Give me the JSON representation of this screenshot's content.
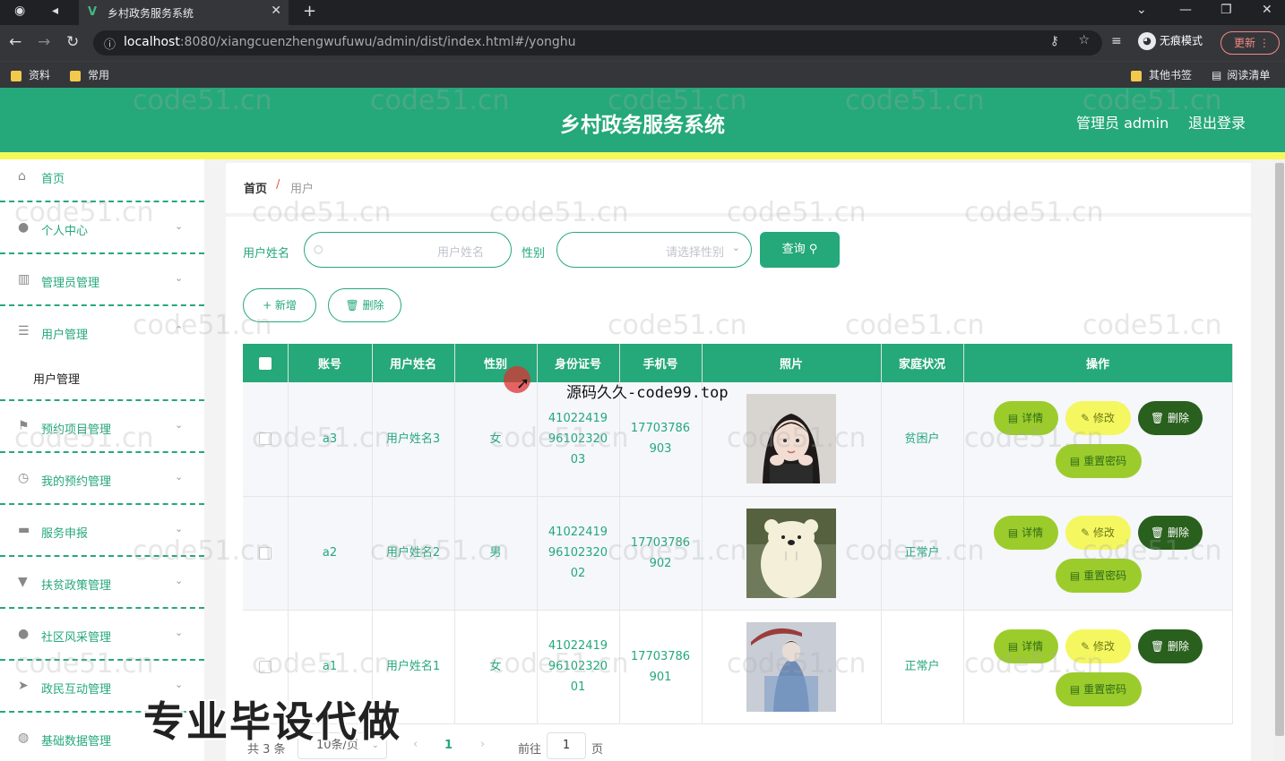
{
  "browser": {
    "tab_title": "乡村政务服务系统",
    "tab_logo": "V",
    "url_host": "localhost",
    "url_rest": ":8080/xiangcuenzhengwufuwu/admin/dist/index.html#/yonghu",
    "incognito_label": "无痕模式",
    "update_label": "更新",
    "bookmarks": [
      "资料",
      "常用"
    ],
    "bookmarks_right": [
      "其他书签",
      "阅读清单"
    ]
  },
  "header": {
    "title": "乡村政务服务系统",
    "admin_label": "管理员 admin",
    "logout_label": "退出登录"
  },
  "sidebar": {
    "items": [
      {
        "label": "首页",
        "icon": "home-icon"
      },
      {
        "label": "个人中心",
        "icon": "user-icon"
      },
      {
        "label": "管理员管理",
        "icon": "books-icon"
      },
      {
        "label": "用户管理",
        "icon": "list-icon"
      },
      {
        "label": "预约项目管理",
        "icon": "flag-icon"
      },
      {
        "label": "我的预约管理",
        "icon": "clock-icon"
      },
      {
        "label": "服务申报",
        "icon": "message-icon"
      },
      {
        "label": "扶贫政策管理",
        "icon": "sign-icon"
      },
      {
        "label": "社区风采管理",
        "icon": "balloon-icon"
      },
      {
        "label": "政民互动管理",
        "icon": "send-icon"
      },
      {
        "label": "基础数据管理",
        "icon": "globe-icon"
      }
    ],
    "submenu_label": "用户管理"
  },
  "breadcrumb": {
    "home": "首页",
    "separator": "/",
    "current": "用户"
  },
  "search": {
    "name_label": "用户姓名",
    "name_placeholder": "用户姓名",
    "gender_label": "性别",
    "gender_placeholder": "请选择性别",
    "query_label": "查询 ⚲"
  },
  "actions": {
    "add_label": "+ 新增",
    "delete_label": "🗑 删除"
  },
  "table": {
    "headers": [
      "账号",
      "用户姓名",
      "性别",
      "身份证号",
      "手机号",
      "照片",
      "家庭状况",
      "操作"
    ],
    "rows": [
      {
        "account": "a3",
        "name": "用户姓名3",
        "gender": "女",
        "id_lines": [
          "41022419",
          "96102320",
          "03"
        ],
        "phone_lines": [
          "17703786",
          "903"
        ],
        "photo": "girl-portrait",
        "family": "贫困户"
      },
      {
        "account": "a2",
        "name": "用户姓名2",
        "gender": "男",
        "id_lines": [
          "41022419",
          "96102320",
          "02"
        ],
        "phone_lines": [
          "17703786",
          "902"
        ],
        "photo": "polar-bear",
        "family": "正常户"
      },
      {
        "account": "a1",
        "name": "用户姓名1",
        "gender": "女",
        "id_lines": [
          "41022419",
          "96102320",
          "01"
        ],
        "phone_lines": [
          "17703786",
          "901"
        ],
        "photo": "umbrella-figure",
        "family": "正常户"
      }
    ],
    "op_labels": {
      "detail": "▤ 详情",
      "edit": "✎ 修改",
      "delete": "🗑 删除",
      "reset": "▤ 重置密码"
    }
  },
  "pagination": {
    "total": "共 3 条",
    "page_size": "10条/页",
    "current_page": "1",
    "goto_label": "前往",
    "goto_value": "1",
    "page_suffix": "页"
  },
  "overlays": {
    "watermark": "code51.cn",
    "code99": "源码久久-code99.top",
    "big_caption": "专业毕设代做"
  },
  "colors": {
    "primary": "#25a87a",
    "accent_yellow": "#f6f85a",
    "detail_btn": "#9ccc2c",
    "edit_btn": "#f4f760",
    "delete_btn": "#29601d"
  }
}
